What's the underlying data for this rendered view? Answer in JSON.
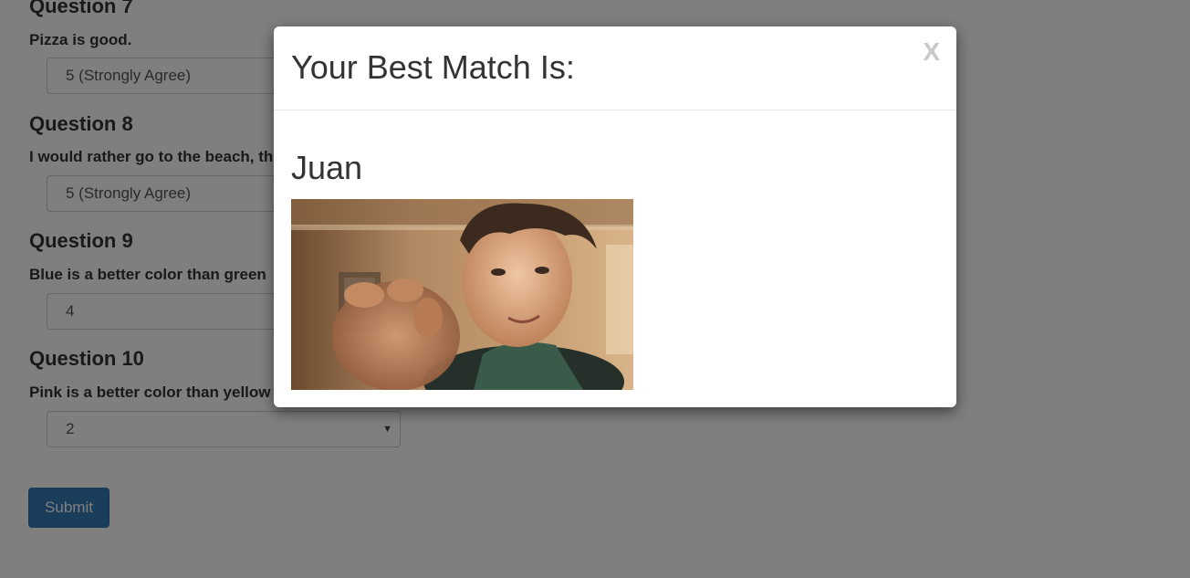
{
  "questions": [
    {
      "title": "Question 7",
      "text": "Pizza is good.",
      "answer": "5 (Strongly Agree)"
    },
    {
      "title": "Question 8",
      "text": "I would rather go to the beach, th",
      "answer": "5 (Strongly Agree)"
    },
    {
      "title": "Question 9",
      "text": "Blue is a better color than green",
      "answer": "4"
    },
    {
      "title": "Question 10",
      "text": "Pink is a better color than yellow",
      "answer": "2"
    }
  ],
  "submit_label": "Submit",
  "modal": {
    "title": "Your Best Match Is:",
    "close_label": "X",
    "match_name": "Juan"
  },
  "colors": {
    "primary": "#337ab7",
    "overlay": "rgba(0,0,0,0.5)"
  }
}
